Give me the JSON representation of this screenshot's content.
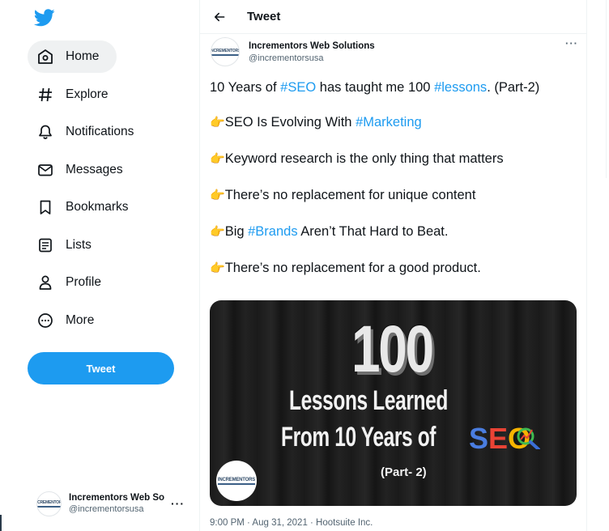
{
  "sidebar": {
    "logo": "twitter-bird-icon",
    "items": [
      {
        "label": "Home",
        "icon": "home-icon",
        "active": true
      },
      {
        "label": "Explore",
        "icon": "hashtag-icon"
      },
      {
        "label": "Notifications",
        "icon": "bell-icon"
      },
      {
        "label": "Messages",
        "icon": "mail-icon"
      },
      {
        "label": "Bookmarks",
        "icon": "bookmark-icon"
      },
      {
        "label": "Lists",
        "icon": "list-icon"
      },
      {
        "label": "Profile",
        "icon": "person-icon"
      },
      {
        "label": "More",
        "icon": "more-circle-icon"
      }
    ],
    "tweet_button": "Tweet",
    "account": {
      "name": "Incrementors Web Solutions",
      "handle": "@incrementorsusa",
      "more": "···"
    }
  },
  "header": {
    "title": "Tweet"
  },
  "tweet": {
    "author_name": "Incrementors Web Solutions",
    "author_handle": "@incrementorsusa",
    "more": "···",
    "avatar_text": "INCREMENTORS",
    "line1": {
      "a": "10 Years of ",
      "tag1": "#SEO",
      "b": " has taught me 100 ",
      "tag2": "#lessons",
      "c": ". (Part-2)"
    },
    "line2": {
      "emoji": "👉",
      "a": "SEO Is Evolving With ",
      "tag": "#Marketing"
    },
    "line3": {
      "emoji": "👉",
      "a": "Keyword research is the only thing that matters"
    },
    "line4": {
      "emoji": "👉",
      "a": "There’s no replacement for unique content"
    },
    "line5": {
      "emoji": "👉",
      "a": "Big ",
      "tag": "#Brands",
      "b": " Aren’t That Hard to Beat."
    },
    "line6": {
      "emoji": "👉",
      "a": "There’s no replacement for a good product."
    },
    "media": {
      "number": "100",
      "line1": "Lessons Learned",
      "line2": "From 10 Years of",
      "seo_s": "S",
      "seo_e": "E",
      "seo_o": "O",
      "part": "(Part- 2)",
      "logo_text": "INCREMENTORS"
    },
    "meta": "9:00 PM · Aug 31, 2021 · Hootsuite Inc."
  },
  "colors": {
    "accent": "#1d9bf0",
    "text": "#0f1419",
    "muted": "#536471"
  }
}
